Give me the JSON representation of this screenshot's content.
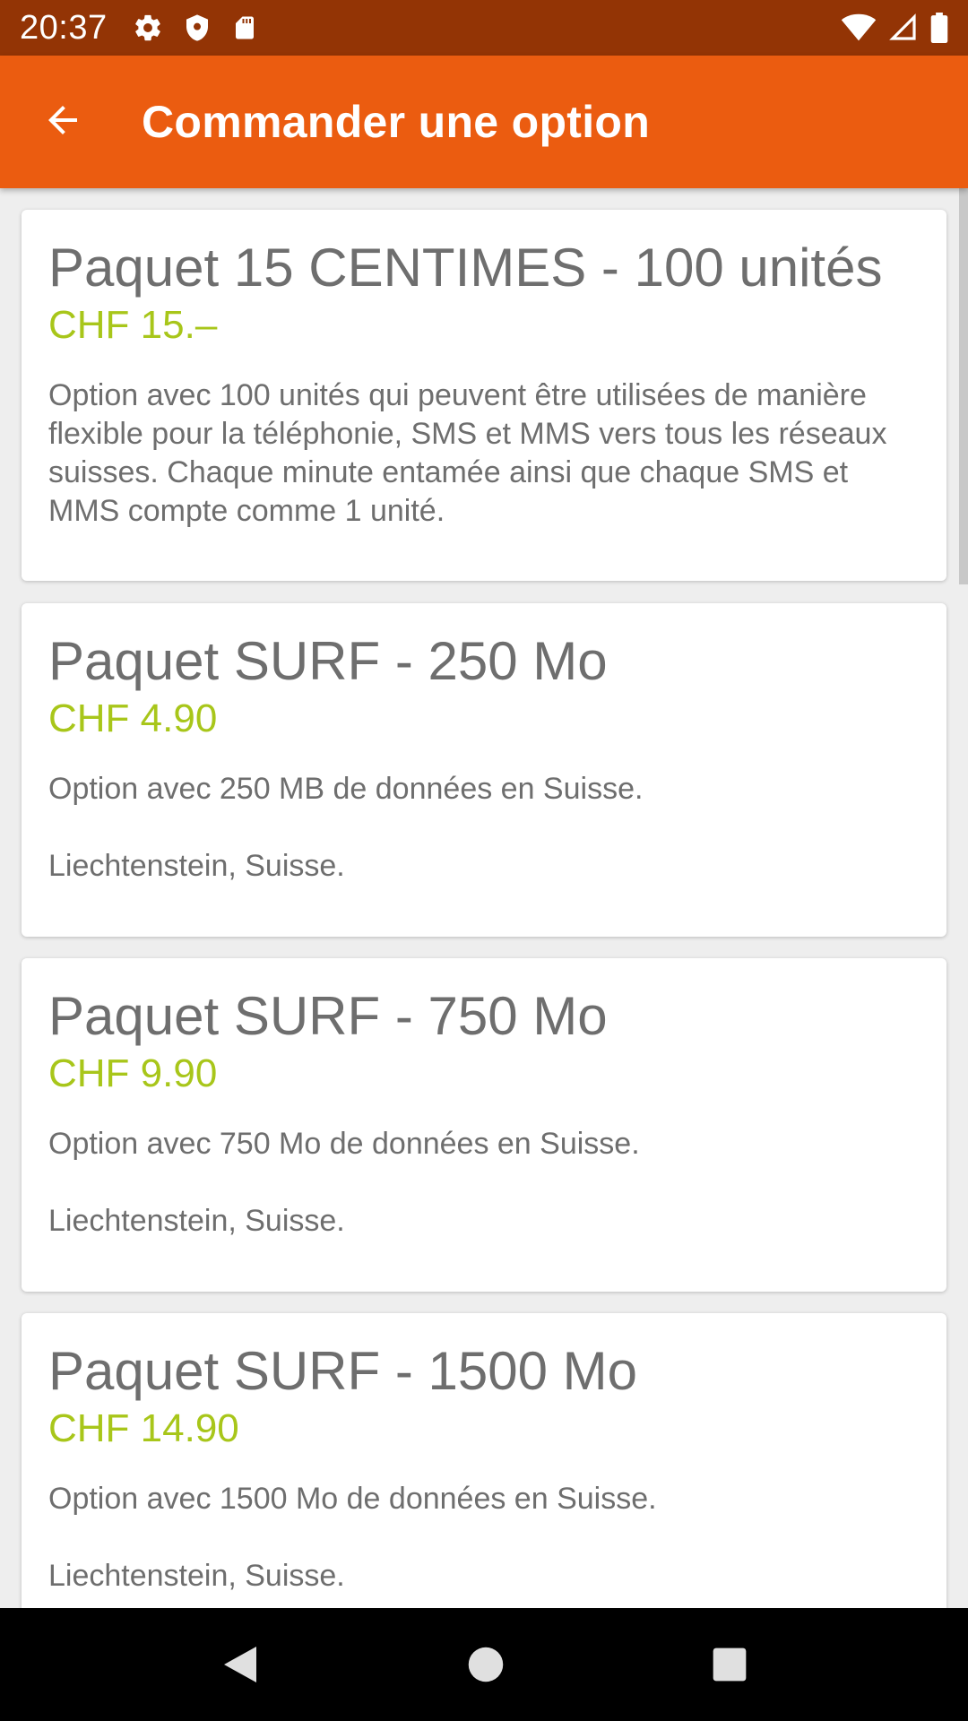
{
  "status_bar": {
    "time": "20:37",
    "left_icons": [
      "settings-icon",
      "shield-icon",
      "sd-card-icon"
    ],
    "right_icons": [
      "wifi-icon",
      "cellular-signal-icon",
      "battery-icon"
    ]
  },
  "app_bar": {
    "back_icon": "arrow-back-icon",
    "title": "Commander une option"
  },
  "options": [
    {
      "title": "Paquet 15 CENTIMES - 100 unités",
      "price": "CHF 15.–",
      "description": "Option avec 100 unités qui peuvent être utilisées de manière flexible pour la téléphonie, SMS et MMS vers tous les réseaux suisses. Chaque minute entamée ainsi que chaque SMS et MMS compte comme 1 unité.",
      "note": ""
    },
    {
      "title": "Paquet SURF - 250 Mo",
      "price": "CHF 4.90",
      "description": "Option avec 250 MB de données en Suisse.",
      "note": "Liechtenstein, Suisse."
    },
    {
      "title": "Paquet SURF - 750 Mo",
      "price": "CHF 9.90",
      "description": "Option avec 750 Mo de données en Suisse.",
      "note": "Liechtenstein, Suisse."
    },
    {
      "title": "Paquet SURF - 1500 Mo",
      "price": "CHF 14.90",
      "description": "Option avec 1500 Mo de données en Suisse.",
      "note": "Liechtenstein, Suisse."
    }
  ],
  "nav_bar": {
    "icons": [
      "nav-back-icon",
      "nav-home-icon",
      "nav-recents-icon"
    ]
  },
  "colors": {
    "status_bar": "#933405",
    "app_bar": "#eb5c10",
    "price": "#a8c61a",
    "text": "#6e6e6e",
    "background": "#eeeeee"
  }
}
